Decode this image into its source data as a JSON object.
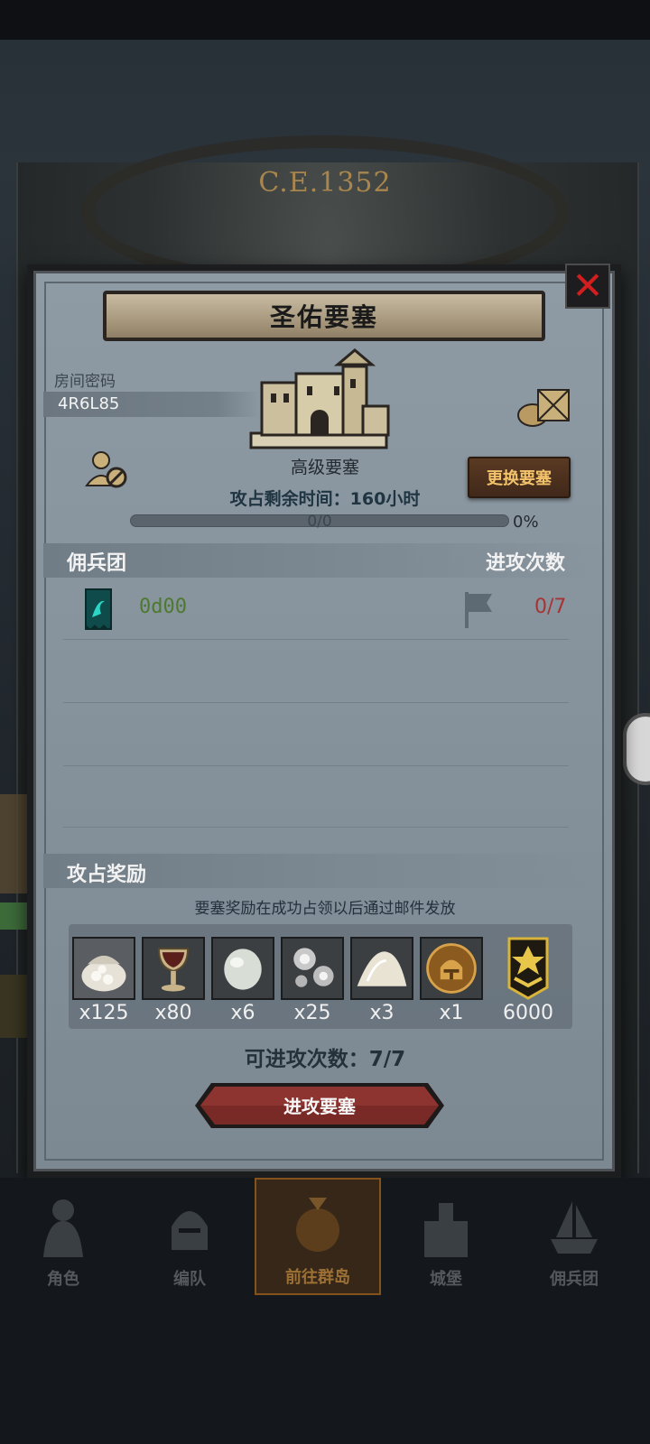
{
  "era": "C.E.1352",
  "dialog": {
    "title": "圣佑要塞",
    "room_label": "房间密码",
    "room_code": "4R6L85",
    "fortress_level": "高级要塞",
    "capture_time": "攻占剩余时间：160小时",
    "progress_text": "0/0",
    "progress_percent": "0%",
    "progress_fraction": 0,
    "change_button": "更换要塞",
    "sections": {
      "mercenary": "佣兵团",
      "attack_count_header": "进攻次数",
      "reward": "攻占奖励"
    },
    "guild": {
      "name": "0d00",
      "attacks": "0/7"
    },
    "reward_note": "要塞奖励在成功占领以后通过邮件发放",
    "rewards": [
      {
        "icon": "sack-icon",
        "count": "x125"
      },
      {
        "icon": "goblet-icon",
        "count": "x80"
      },
      {
        "icon": "gem-icon",
        "count": "x6"
      },
      {
        "icon": "silver-icon",
        "count": "x25"
      },
      {
        "icon": "salt-icon",
        "count": "x3"
      },
      {
        "icon": "helmet-icon",
        "count": "x1"
      },
      {
        "icon": "rank-badge-icon",
        "count": "6000"
      }
    ],
    "attack_remaining": "可进攻次数：7/7",
    "attack_button": "进攻要塞"
  },
  "nav": [
    {
      "label": "角色",
      "icon": "knight-icon"
    },
    {
      "label": "编队",
      "icon": "helmet-icon"
    },
    {
      "label": "前往群岛",
      "icon": "compass-globe-icon"
    },
    {
      "label": "城堡",
      "icon": "castle-icon"
    },
    {
      "label": "佣兵团",
      "icon": "ship-icon"
    }
  ],
  "colors": {
    "accent_gold": "#f2c36b",
    "attack_red": "#a63434",
    "guild_green": "#4c7a2e",
    "close_red": "#d21e1e"
  }
}
